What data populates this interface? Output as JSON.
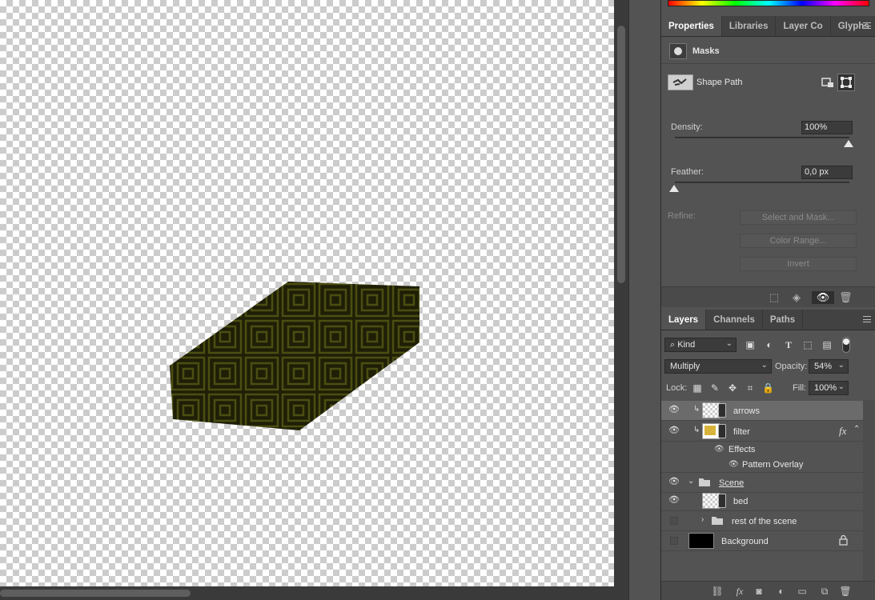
{
  "properties_tabs": [
    {
      "label": "Properties",
      "active": true
    },
    {
      "label": "Libraries",
      "active": false
    },
    {
      "label": "Layer Co",
      "active": false
    },
    {
      "label": "Glyphs",
      "active": false
    }
  ],
  "masks": {
    "title": "Masks",
    "shape_path_label": "Shape Path",
    "density_label": "Density:",
    "density_value": "100%",
    "density_level": 1.0,
    "feather_label": "Feather:",
    "feather_value": "0,0 px",
    "feather_level": 0.0,
    "refine_label": "Refine:",
    "select_and_mask": "Select and Mask...",
    "color_range": "Color Range...",
    "invert": "Invert"
  },
  "layers_tabs": [
    {
      "label": "Layers",
      "active": true
    },
    {
      "label": "Channels",
      "active": false
    },
    {
      "label": "Paths",
      "active": false
    }
  ],
  "layers_panel": {
    "kind_label": "Kind",
    "blend_mode": "Multiply",
    "opacity_label": "Opacity:",
    "opacity_value": "54%",
    "lock_label": "Lock:",
    "fill_label": "Fill:",
    "fill_value": "100%"
  },
  "layers": {
    "arrows": "arrows",
    "filter": "filter",
    "effects": "Effects",
    "pattern_overlay": "Pattern Overlay",
    "scene": "Scene",
    "bed": "bed",
    "rest": "rest of the scene",
    "background": "Background"
  },
  "colors": {
    "pattern_dark": "#1e1f06",
    "pattern_line": "#4b4e12",
    "filter_swatch": "#d9b43a"
  },
  "icons": {
    "fx": "fx",
    "eye": "eye-icon",
    "lock": "lock-icon",
    "folder": "folder-icon"
  }
}
